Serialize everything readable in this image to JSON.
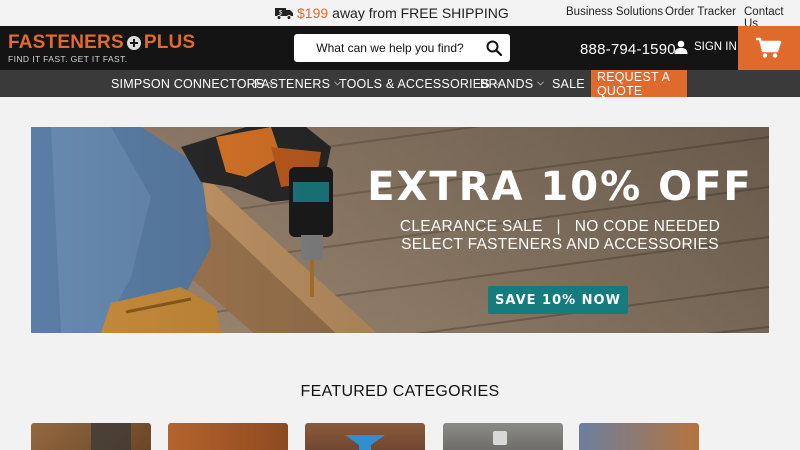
{
  "topbar": {
    "shipping": {
      "amount": "$199",
      "text": "away from FREE SHIPPING",
      "icon": "truck-icon"
    },
    "links": [
      "Business Solutions",
      "Order Tracker",
      "Contact Us"
    ]
  },
  "header": {
    "logo": {
      "name_left": "FASTENERS",
      "name_right": "PLUS",
      "tagline": "FIND IT FAST. GET IT FAST."
    },
    "search": {
      "placeholder": "What can we help you find?",
      "icon": "search-icon"
    },
    "phone": "888-794-1590",
    "signin": {
      "label": "SIGN IN",
      "icon": "user-icon"
    },
    "cart": {
      "icon": "cart-icon"
    }
  },
  "nav": {
    "items": [
      {
        "label": "SIMPSON CONNECTORS"
      },
      {
        "label": "FASTENERS"
      },
      {
        "label": "TOOLS & ACCESSORIES"
      },
      {
        "label": "BRANDS"
      },
      {
        "label": "SALE"
      },
      {
        "label": "REQUEST A QUOTE"
      }
    ]
  },
  "banner": {
    "headline": "EXTRA 10% OFF",
    "line1": "CLEARANCE SALE   |   NO CODE NEEDED",
    "line2": "SELECT FASTENERS AND ACCESSORIES",
    "cta": "SAVE 10% NOW"
  },
  "featured": {
    "title": "FEATURED CATEGORIES"
  },
  "colors": {
    "accent": "#e0692c",
    "header_bg": "#141414",
    "nav_bg": "#3a3a3a",
    "cta_bg": "#157b7d"
  }
}
